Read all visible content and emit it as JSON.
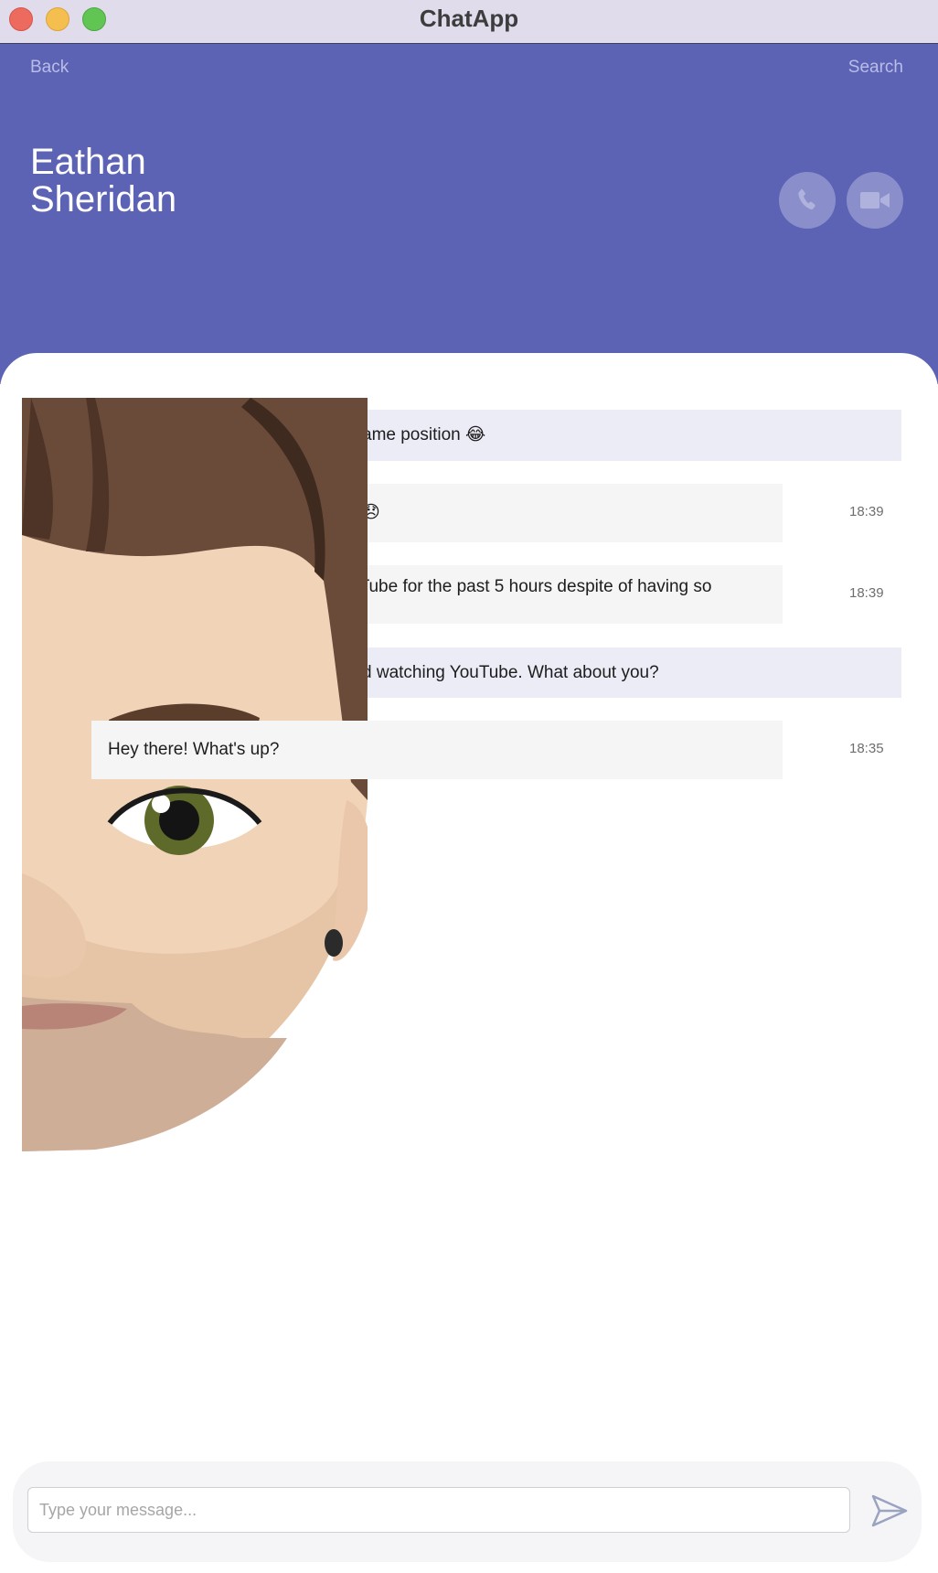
{
  "window": {
    "title": "ChatApp"
  },
  "header": {
    "back_label": "Back",
    "search_label": "Search",
    "contact_first_name": "Eathan",
    "contact_last_name": "Sheridan",
    "call_icon": "phone-icon",
    "video_icon": "video-camera-icon",
    "accent_color": "#5c63b5"
  },
  "messages": [
    {
      "direction": "sent",
      "text": "ame position 😂",
      "time": ""
    },
    {
      "direction": "received",
      "text": "😞",
      "time": "18:39"
    },
    {
      "direction": "received",
      "text": "uTube for the past 5 hours despite of having so",
      "time": "18:39"
    },
    {
      "direction": "sent",
      "text": "d watching YouTube. What about you?",
      "time": ""
    },
    {
      "direction": "received",
      "text": "Hey there! What's up?",
      "time": "18:35"
    }
  ],
  "composer": {
    "placeholder": "Type your message...",
    "value": "",
    "send_icon": "send-icon"
  }
}
